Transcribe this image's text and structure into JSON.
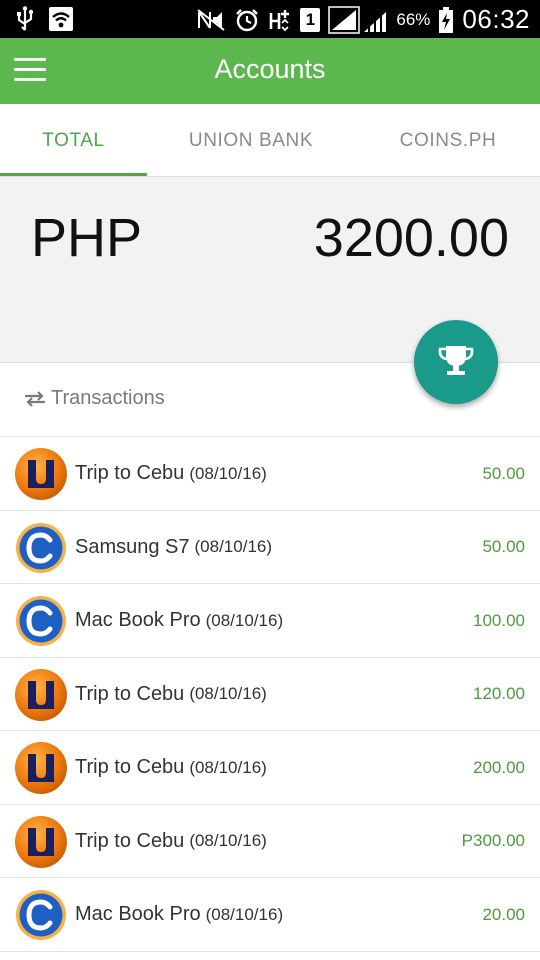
{
  "status_bar": {
    "battery_percent": "66%",
    "time": "06:32",
    "sim_slot": "1",
    "icons": [
      "usb-icon",
      "wifi-icon",
      "nfc-mute-icon",
      "alarm-icon",
      "hplus-data-icon",
      "signal-icon",
      "battery-charging-icon"
    ]
  },
  "app_bar": {
    "title": "Accounts",
    "menu_icon": "hamburger-menu-icon"
  },
  "tabs": [
    {
      "label": "TOTAL",
      "active": true
    },
    {
      "label": "UNION BANK",
      "active": false
    },
    {
      "label": "COINS.PH",
      "active": false
    }
  ],
  "balance": {
    "currency": "PHP",
    "amount": "3200.00"
  },
  "fab": {
    "icon": "trophy-icon"
  },
  "transactions_header": {
    "icon": "swap-arrows-icon",
    "label": "Transactions"
  },
  "transactions": [
    {
      "source": "unionbank",
      "name": "Trip to Cebu",
      "date": "(08/10/16)",
      "amount": "50.00"
    },
    {
      "source": "coins",
      "name": "Samsung S7",
      "date": "(08/10/16)",
      "amount": "50.00"
    },
    {
      "source": "coins",
      "name": "Mac Book Pro",
      "date": "(08/10/16)",
      "amount": "100.00"
    },
    {
      "source": "unionbank",
      "name": "Trip to Cebu",
      "date": "(08/10/16)",
      "amount": "120.00"
    },
    {
      "source": "unionbank",
      "name": "Trip to Cebu",
      "date": "(08/10/16)",
      "amount": "200.00"
    },
    {
      "source": "unionbank",
      "name": "Trip to Cebu",
      "date": "(08/10/16)",
      "amount": "P300.00"
    },
    {
      "source": "coins",
      "name": "Mac Book Pro",
      "date": "(08/10/16)",
      "amount": "20.00"
    }
  ],
  "colors": {
    "primary": "#5cb74e",
    "accent_fab": "#1a9a8a",
    "amount_green": "#4e9a3e",
    "unionbank_orange": "#f07d10",
    "coins_blue": "#1f5fc4"
  }
}
